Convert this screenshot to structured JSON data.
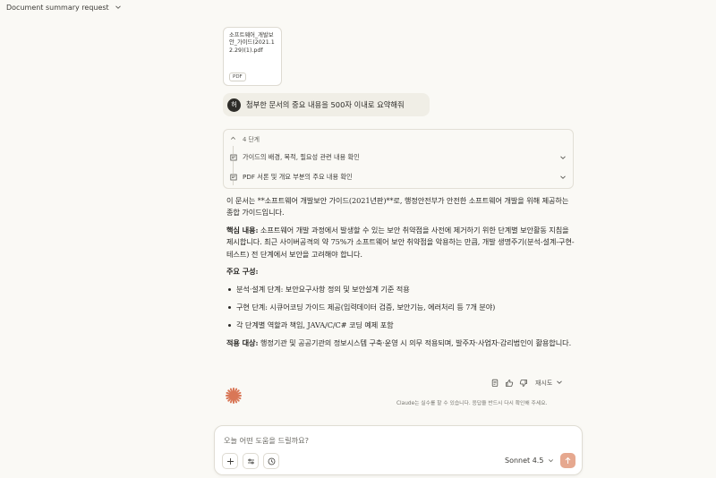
{
  "header": {
    "title": "Document summary request"
  },
  "attachment": {
    "filename": "소프트웨어_개발보안_가이드(2021.12.29)(1).pdf",
    "type_badge": "PDF"
  },
  "user_message": {
    "avatar_initial": "허",
    "text": "첨부한 문서의 중요 내용을 500자 이내로 요약해줘"
  },
  "steps": {
    "header": "4 단계",
    "items": [
      {
        "label": "가이드의 배경, 목적, 필요성 관련 내용 확인"
      },
      {
        "label": "PDF 서론 및 개요 부분의 주요 내용 확인"
      }
    ]
  },
  "answer": {
    "intro": "이 문서는 **소프트웨어 개발보안 가이드(2021년판)**로, 행정안전부가 안전한 소프트웨어 개발을 위해 제공하는 종합 가이드입니다.",
    "core_label": "핵심 내용:",
    "core_text": " 소프트웨어 개발 과정에서 발생할 수 있는 보안 취약점을 사전에 제거하기 위한 단계별 보안활동 지침을 제시합니다. 최근 사이버공격의 약 75%가 소프트웨어 보안 취약점을 악용하는 만큼, 개발 생명주기(분석-설계-구현-테스트) 전 단계에서 보안을 고려해야 합니다.",
    "structure_heading": "주요 구성:",
    "bullets": [
      "분석·설계 단계: 보안요구사항 정의 및 보안설계 기준 적용",
      "구현 단계: 시큐어코딩 가이드 제공(입력데이터 검증, 보안기능, 에러처리 등 7개 분야)",
      "각 단계별 역할과 책임, JAVA/C/C# 코딩 예제 포함"
    ],
    "target_label": "적용 대상:",
    "target_text": " 행정기관 및 공공기관의 정보시스템 구축·운영 시 의무 적용되며, 발주자·사업자·감리법인이 활용합니다."
  },
  "actions": {
    "copy_icon": "copy-icon",
    "thumbs_up_icon": "thumbs-up-icon",
    "thumbs_down_icon": "thumbs-down-icon",
    "retry_label": "재시도"
  },
  "disclaimer": "Claude는 실수를 할 수 있습니다. 응답을 반드시 다시 확인해 주세요.",
  "composer": {
    "placeholder": "오늘 어떤 도움을 드릴까요?",
    "model": "Sonnet 4.5"
  },
  "colors": {
    "background": "#faf9f5",
    "accent": "#d97757",
    "send_button": "#e6a88f"
  }
}
